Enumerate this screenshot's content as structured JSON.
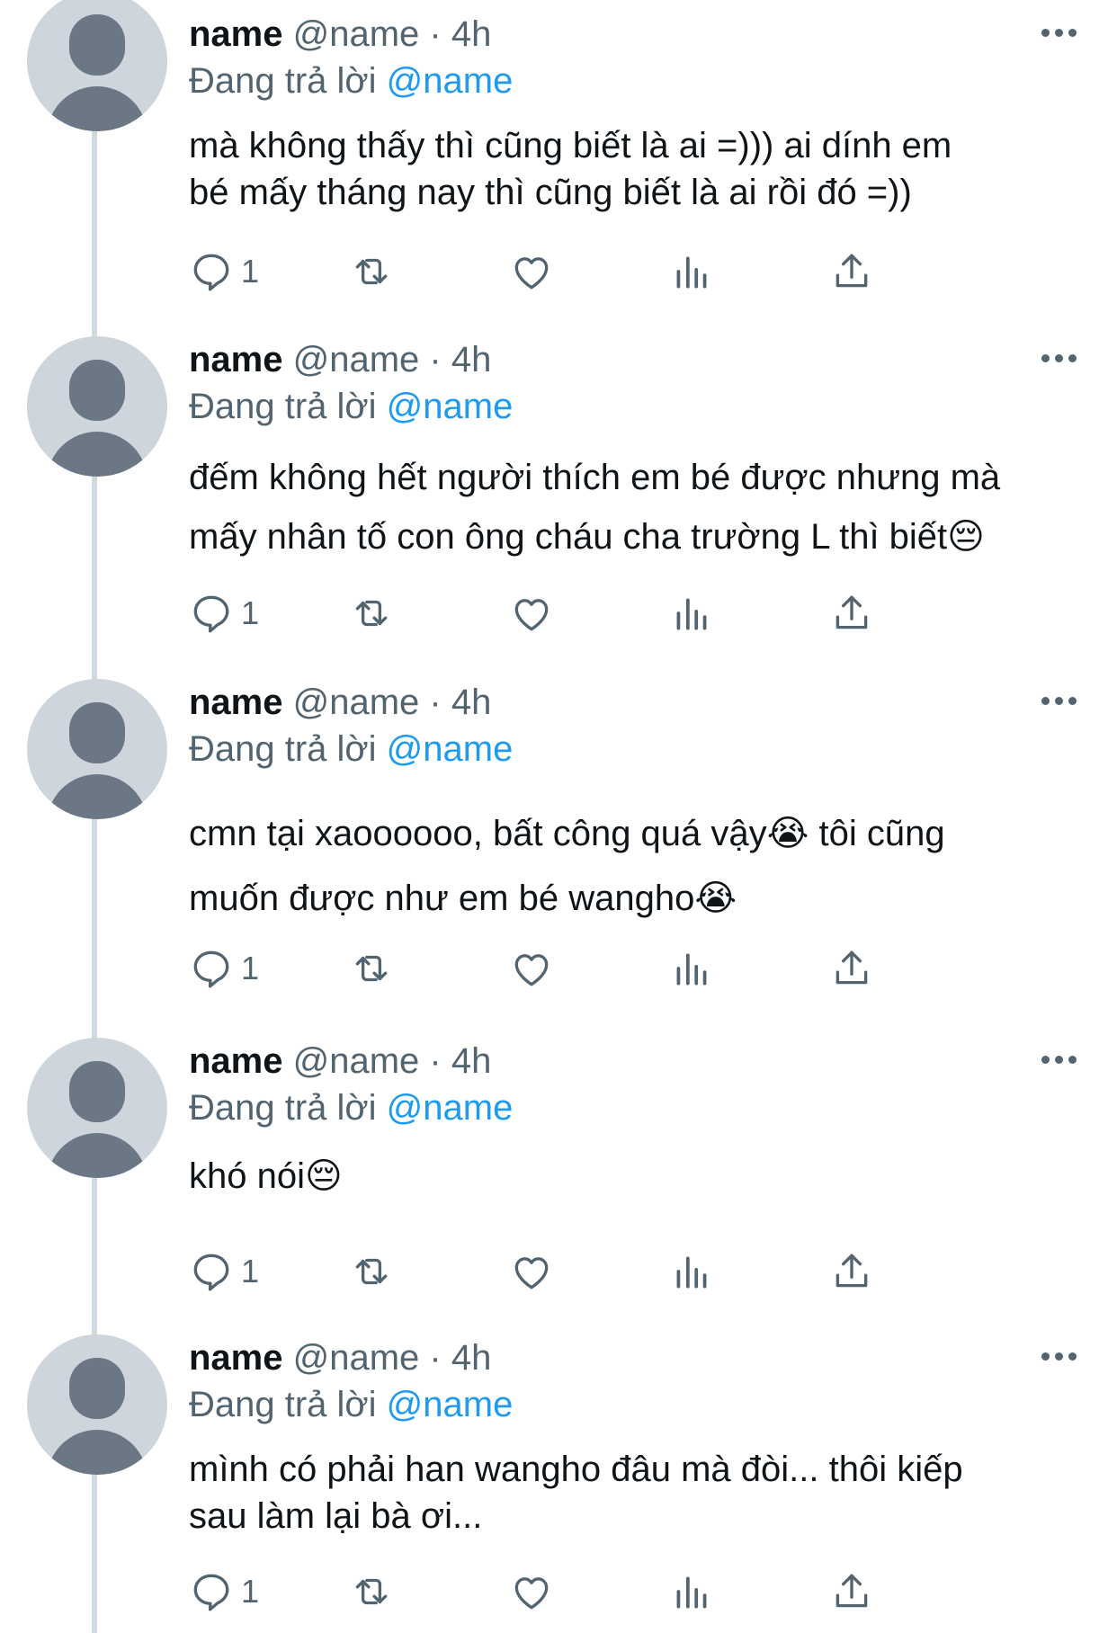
{
  "tweets": [
    {
      "display_name": "name",
      "handle": "@name",
      "separator": "·",
      "time": "4h",
      "reply_prefix": "Đang trả lời",
      "reply_to": "@name",
      "text_lines": [
        "mà không thấy thì cũng biết là ai =))) ai dính em",
        "bé mấy tháng nay thì cũng biết là ai rồi đó =))"
      ],
      "reply_count": "1"
    },
    {
      "display_name": "name",
      "handle": "@name",
      "separator": "·",
      "time": "4h",
      "reply_prefix": "Đang trả lời",
      "reply_to": "@name",
      "text_lines": [
        "đếm không hết người thích em bé được nhưng mà",
        "mấy nhân tố con ông cháu cha trường L thì biết😔"
      ],
      "reply_count": "1"
    },
    {
      "display_name": "name",
      "handle": "@name",
      "separator": "·",
      "time": "4h",
      "reply_prefix": "Đang trả lời",
      "reply_to": "@name",
      "text_lines": [
        "cmn tại xaoooooo, bất công quá vậy😭  tôi cũng",
        "muốn được như em bé wangho😭"
      ],
      "reply_count": "1"
    },
    {
      "display_name": "name",
      "handle": "@name",
      "separator": "·",
      "time": "4h",
      "reply_prefix": "Đang trả lời",
      "reply_to": "@name",
      "text_lines": [
        "khó nói😔"
      ],
      "reply_count": "1"
    },
    {
      "display_name": "name",
      "handle": "@name",
      "separator": "·",
      "time": "4h",
      "reply_prefix": "Đang trả lời",
      "reply_to": "@name",
      "text_lines": [
        "mình có phải han wangho đâu mà đòi... thôi kiếp",
        "sau làm lại bà ơi..."
      ],
      "reply_count": "1"
    }
  ],
  "icons": {
    "reply": "reply-icon",
    "retweet": "retweet-icon",
    "like": "like-icon",
    "views": "views-icon",
    "share": "share-icon",
    "more": "more-icon",
    "avatar": "default-avatar"
  },
  "colors": {
    "mention": "#1d9bf0",
    "secondary": "#536471",
    "thread_line": "#cfd9de",
    "avatar_bg": "#ced5dd",
    "avatar_fg": "#6b7784"
  }
}
